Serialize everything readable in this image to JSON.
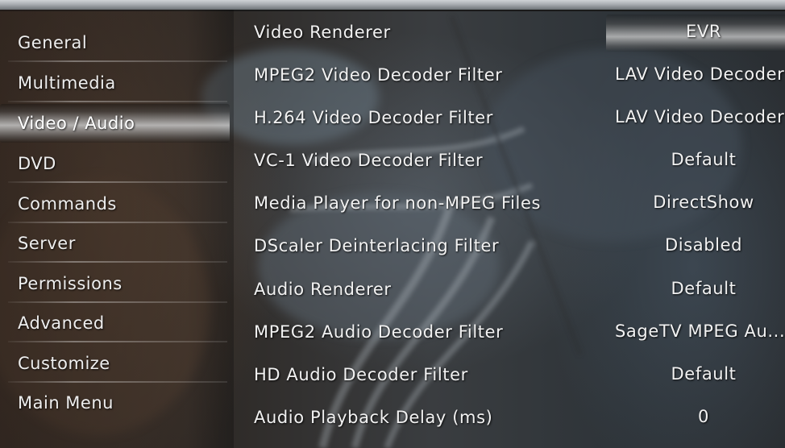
{
  "menu": {
    "items": [
      {
        "label": "General"
      },
      {
        "label": "Multimedia"
      },
      {
        "label": "Video / Audio"
      },
      {
        "label": "DVD"
      },
      {
        "label": "Commands"
      },
      {
        "label": "Server"
      },
      {
        "label": "Permissions"
      },
      {
        "label": "Advanced"
      },
      {
        "label": "Customize"
      },
      {
        "label": "Main Menu"
      }
    ],
    "selected": "Video / Audio"
  },
  "settings": {
    "rows": [
      {
        "label": "Video Renderer",
        "value": "EVR"
      },
      {
        "label": "MPEG2 Video Decoder Filter",
        "value": "LAV Video Decoder"
      },
      {
        "label": "H.264 Video Decoder Filter",
        "value": "LAV Video Decoder"
      },
      {
        "label": "VC-1 Video Decoder Filter",
        "value": "Default"
      },
      {
        "label": "Media Player for non-MPEG Files",
        "value": "DirectShow"
      },
      {
        "label": "DScaler Deinterlacing Filter",
        "value": "Disabled"
      },
      {
        "label": "Audio Renderer",
        "value": "Default"
      },
      {
        "label": "MPEG2 Audio Decoder Filter",
        "value": "SageTV MPEG Au..."
      },
      {
        "label": "HD Audio Decoder Filter",
        "value": "Default"
      },
      {
        "label": "Audio Playback Delay (ms)",
        "value": "0"
      }
    ],
    "selected": "Video Renderer"
  },
  "colors": {
    "text": "#f2f2f2",
    "highlight": "#d2d2d2",
    "top_bar": "#a9adb2"
  }
}
